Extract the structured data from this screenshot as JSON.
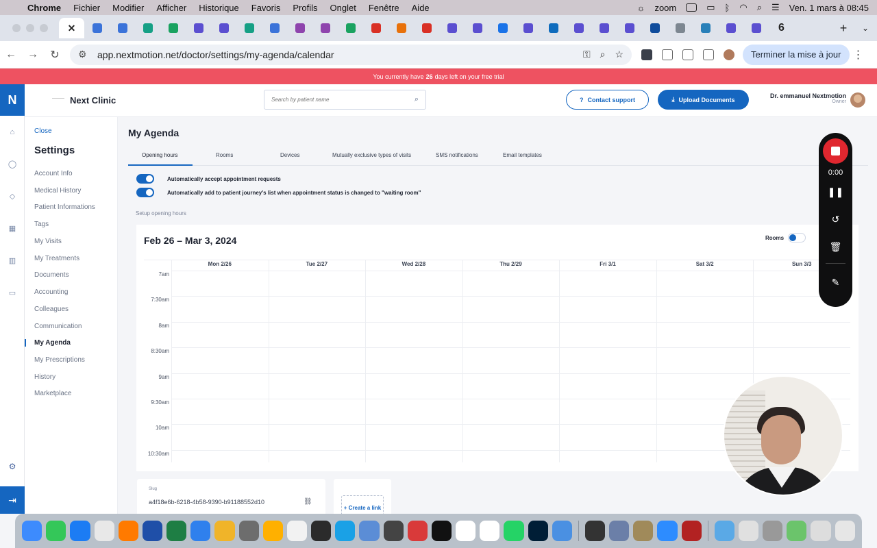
{
  "menubar": {
    "app": "Chrome",
    "items": [
      "Fichier",
      "Modifier",
      "Afficher",
      "Historique",
      "Favoris",
      "Profils",
      "Onglet",
      "Fenêtre",
      "Aide"
    ],
    "zoom": "zoom",
    "datetime": "Ven. 1 mars à 08:45"
  },
  "tabstrip": {
    "active_tab_close": "✕",
    "counter": "6",
    "new_tab": "+",
    "menu": "⌄"
  },
  "address_bar": {
    "url": "app.nextmotion.net/doctor/settings/my-agenda/calendar",
    "finish_setup": "Terminer la mise à jour"
  },
  "trial": {
    "prefix": "You currently have",
    "days": "26",
    "suffix": "days left on your free trial"
  },
  "rail": {
    "logo": "N"
  },
  "header": {
    "clinic_name": "Next Clinic",
    "search_placeholder": "Search by patient name",
    "contact_label": "Contact support",
    "upload_label": "Upload Documents",
    "user_name": "Dr. emmanuel Nextmotion",
    "user_role": "Owner"
  },
  "sidebar": {
    "close": "Close",
    "title": "Settings",
    "items": [
      {
        "label": "Account Info"
      },
      {
        "label": "Medical History"
      },
      {
        "label": "Patient Informations"
      },
      {
        "label": "Tags"
      },
      {
        "label": "My Visits"
      },
      {
        "label": "My Treatments"
      },
      {
        "label": "Documents"
      },
      {
        "label": "Accounting"
      },
      {
        "label": "Colleagues"
      },
      {
        "label": "Communication"
      },
      {
        "label": "My Agenda"
      },
      {
        "label": "My Prescriptions"
      },
      {
        "label": "History"
      },
      {
        "label": "Marketplace"
      }
    ]
  },
  "main": {
    "title": "My Agenda",
    "tabs": [
      "Opening hours",
      "Rooms",
      "Devices",
      "Mutually exclusive types of visits",
      "SMS notifications",
      "Email templates"
    ],
    "toggle1": "Automatically accept appointment requests",
    "toggle2": "Automatically add to patient journey's list when appointment status is changed to \"waiting room\"",
    "setup_label": "Setup opening hours",
    "calendar": {
      "range": "Feb 26 – Mar 3, 2024",
      "rooms_label": "Rooms",
      "days": [
        "Mon 2/26",
        "Tue 2/27",
        "Wed 2/28",
        "Thu 2/29",
        "Fri 3/1",
        "Sat 3/2",
        "Sun 3/3"
      ],
      "times": [
        "7am",
        "7:30am",
        "8am",
        "8:30am",
        "9am",
        "9:30am",
        "10am",
        "10:30am"
      ]
    },
    "slug_label": "Slug",
    "slug_value": "a4f18e6b-6218-4b58-9390-b91188552d10",
    "create_link": "+ Create a link"
  },
  "recorder": {
    "timer": "0:00"
  },
  "colors": {
    "brand": "#1566c0",
    "trial_banner": "#ee5261",
    "recorder_stop": "#e0272f"
  }
}
